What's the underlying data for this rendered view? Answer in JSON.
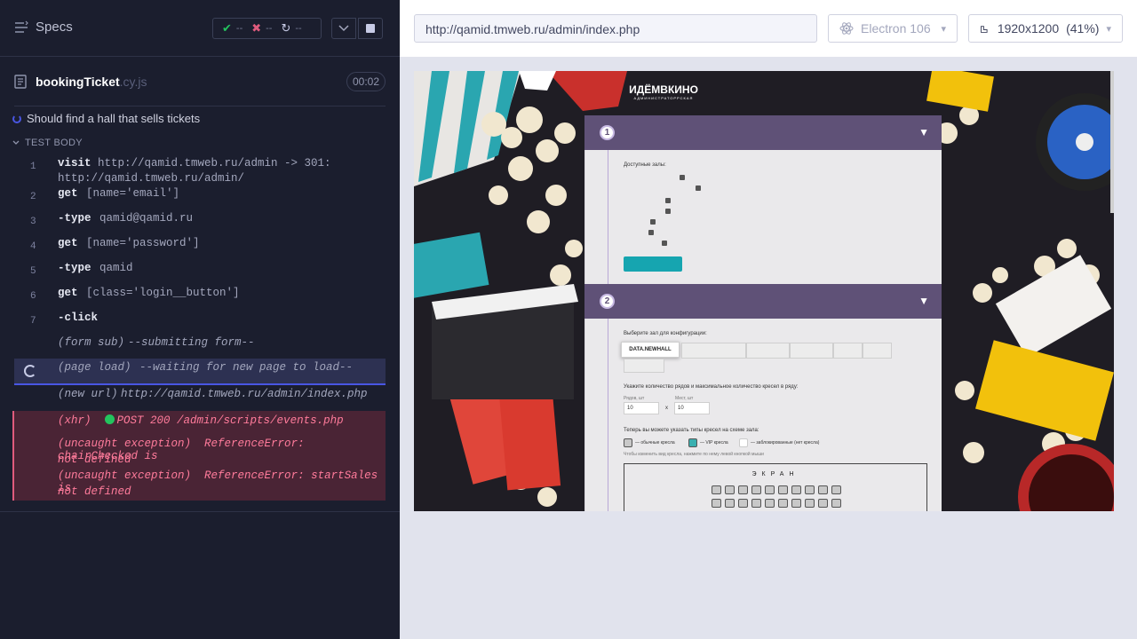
{
  "reporter": {
    "specs_label": "Specs",
    "stats": {
      "passed": "--",
      "failed": "--",
      "pending": "--"
    },
    "file": {
      "name": "bookingTicket",
      "ext": ".cy.js",
      "duration": "00:02"
    },
    "test_title": "Should find a hall that sells tickets",
    "test_body_label": "TEST BODY",
    "commands": [
      {
        "num": "1",
        "name": "visit",
        "msg": "http://qamid.tmweb.ru/admin -> 301:",
        "msg2": "http://qamid.tmweb.ru/admin/"
      },
      {
        "num": "2",
        "name": "get",
        "msg": "[name='email']"
      },
      {
        "num": "3",
        "name": "-type",
        "msg": "qamid@qamid.ru"
      },
      {
        "num": "4",
        "name": "get",
        "msg": "[name='password']"
      },
      {
        "num": "5",
        "name": "-type",
        "msg": "qamid"
      },
      {
        "num": "6",
        "name": "get",
        "msg": "[class='login__button']"
      },
      {
        "num": "7",
        "name": "-click",
        "msg": ""
      },
      {
        "num": "",
        "name": "(form sub)",
        "msg": "--submitting form--"
      },
      {
        "num": "",
        "name": "(page load)",
        "msg": "--waiting for new page to load--"
      },
      {
        "num": "",
        "name": "(new url)",
        "msg": "http://qamid.tmweb.ru/admin/index.php"
      }
    ],
    "xhr": {
      "name": "(xhr)",
      "msg": "POST 200 /admin/scripts/events.php"
    },
    "exceptions": [
      {
        "name": "(uncaught exception)",
        "msg": "ReferenceError: chairChecked is",
        "msg2": "not defined"
      },
      {
        "name": "(uncaught exception)",
        "msg": "ReferenceError: startSales is",
        "msg2": "not defined"
      }
    ]
  },
  "preview": {
    "url": "http://qamid.tmweb.ru/admin/index.php",
    "browser": "Electron 106",
    "viewport": "1920x1200",
    "zoom": "(41%)"
  },
  "aut": {
    "logo": "ИДЁМВКИНО",
    "logo_sub": "АДМИНИСТРАТОРРСКАЯ",
    "section1": {
      "num": "1",
      "label": "Доступные залы:"
    },
    "section2": {
      "num": "2",
      "label": "Выберите зал для конфигурации:",
      "active_hall": "DATA.NEWHALL",
      "rows_label": "Укажите количество рядов и максимальное количество кресел в ряду:",
      "rows_field_label": "Рядов, шт",
      "seats_field_label": "Мест, шт",
      "rows_value": "10",
      "seats_value": "10",
      "times": "x",
      "types_label": "Теперь вы можете указать типы кресел на схеме зала:",
      "type_regular": "— обычные кресла",
      "type_vip": "— VIP кресла",
      "type_blocked": "— заблокированные (нет кресла)",
      "hint": "Чтобы изменить вид кресла, нажмите по нему левой кнопкой мыши",
      "screen": "ЭКРАН"
    }
  },
  "colors": {
    "reporter_bg": "#1b1e2e",
    "accent": "#4956e3",
    "error_bg": "#4a2435",
    "error_text": "#ff7b9b",
    "panel_header": "#5f5177",
    "teal": "#16a5b0"
  }
}
